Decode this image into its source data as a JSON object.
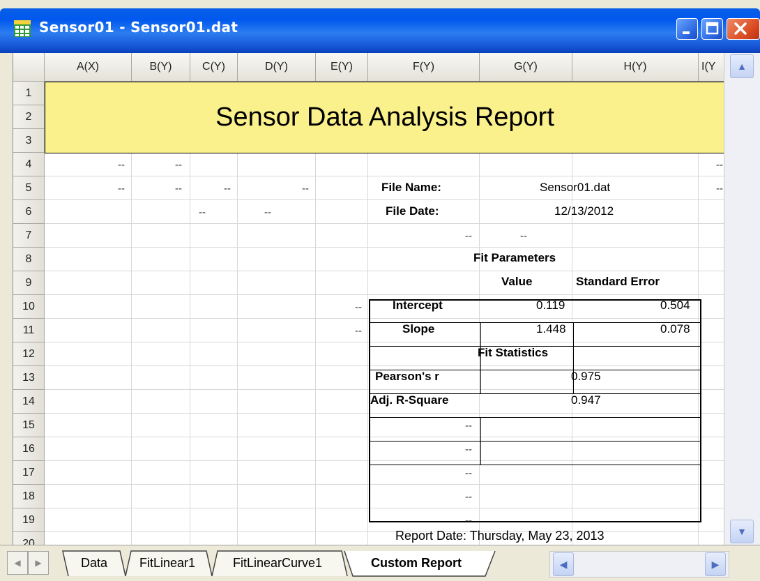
{
  "window": {
    "title": "Sensor01 - Sensor01.dat",
    "icon": "worksheet-grid-icon"
  },
  "columns": [
    "A(X)",
    "B(Y)",
    "C(Y)",
    "D(Y)",
    "E(Y)",
    "F(Y)",
    "G(Y)",
    "H(Y)",
    "I(Y"
  ],
  "rows": [
    "1",
    "2",
    "3",
    "4",
    "5",
    "6",
    "7",
    "8",
    "9",
    "10",
    "11",
    "12",
    "13",
    "14",
    "15",
    "16",
    "17",
    "18",
    "19",
    "20"
  ],
  "placeholder": "--",
  "report": {
    "title": "Sensor Data Analysis Report",
    "file_name_label": "File Name:",
    "file_name_value": "Sensor01.dat",
    "file_date_label": "File Date:",
    "file_date_value": "12/13/2012",
    "fit_parameters_header": "Fit Parameters",
    "value_header": "Value",
    "std_error_header": "Standard Error",
    "params": [
      {
        "name": "Intercept",
        "value": "0.119",
        "error": "0.504"
      },
      {
        "name": "Slope",
        "value": "1.448",
        "error": "0.078"
      }
    ],
    "fit_statistics_header": "Fit Statistics",
    "stats": [
      {
        "name": "Pearson's r",
        "value": "0.975"
      },
      {
        "name": "Adj. R-Square",
        "value": "0.947"
      }
    ],
    "report_date": "Report Date: Thursday, May 23, 2013"
  },
  "tabs": [
    {
      "label": "Data",
      "active": false
    },
    {
      "label": "FitLinear1",
      "active": false
    },
    {
      "label": "FitLinearCurve1",
      "active": false
    },
    {
      "label": "Custom Report",
      "active": true
    }
  ],
  "colors": {
    "banner": "#faf08c",
    "title_bar": "#0058ee"
  }
}
